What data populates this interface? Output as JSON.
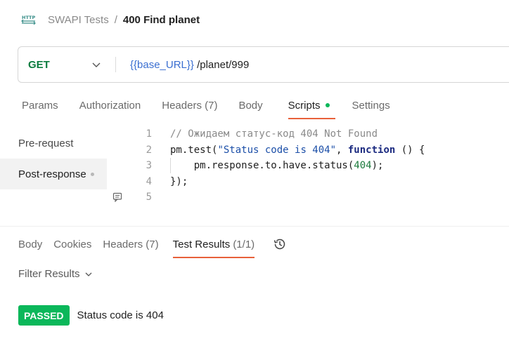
{
  "header": {
    "icon": "http-icon",
    "collection": "SWAPI Tests",
    "separator": "/",
    "request_name": "400 Find planet"
  },
  "url_bar": {
    "method": "GET",
    "url_variable": "{{base_URL}}",
    "url_path": " /planet/999"
  },
  "request_tabs": [
    {
      "label": "Params"
    },
    {
      "label": "Authorization"
    },
    {
      "label": "Headers (7)"
    },
    {
      "label": "Body"
    },
    {
      "label": "Scripts",
      "active": true,
      "indicator": "green-dot"
    },
    {
      "label": "Settings"
    }
  ],
  "scripts_nav": [
    {
      "label": "Pre-request"
    },
    {
      "label": "Post-response",
      "active": true
    }
  ],
  "editor": {
    "lines": [
      {
        "number": "1",
        "comment": "// Ожидаем статус-код 404 Not Found"
      },
      {
        "number": "2",
        "p1": "pm.test(",
        "str": "\"Status code is 404\"",
        "p2": ", ",
        "kw": "function",
        "p3": " () {"
      },
      {
        "number": "3",
        "p1": "    pm.response.to.have.status(",
        "num": "404",
        "p2": ");"
      },
      {
        "number": "4",
        "p1": "});"
      },
      {
        "number": "5",
        "p1": ""
      }
    ]
  },
  "response_tabs": [
    {
      "label": "Body"
    },
    {
      "label": "Cookies"
    },
    {
      "label": "Headers (7)"
    },
    {
      "label": "Test Results",
      "count": "(1/1)",
      "active": true
    }
  ],
  "filter": {
    "label": "Filter Results"
  },
  "results": [
    {
      "status": "PASSED",
      "name": "Status code is 404"
    }
  ],
  "colors": {
    "accent": "#e8613a",
    "get_method": "#0a7b3e",
    "passed": "#0bb75a",
    "url_variable": "#3b6fd1"
  }
}
